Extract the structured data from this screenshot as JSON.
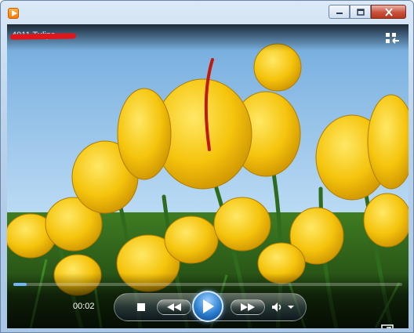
{
  "window": {
    "app_icon": "media-player-icon",
    "title_caption": "",
    "buttons": {
      "minimize": "minimize-icon",
      "maximize": "maximize-icon",
      "close": "close-icon"
    }
  },
  "media": {
    "title": "4011 Tulips",
    "switch_icon": "switch-to-library-icon"
  },
  "playback": {
    "time": "00:02",
    "progress": 0.035,
    "icons": {
      "stop": "stop-icon",
      "previous": "previous-icon",
      "play": "play-icon",
      "next": "next-icon",
      "mute": "speaker-icon",
      "volume": "chevron-down-icon",
      "fullscreen": "fullscreen-icon"
    }
  },
  "colors": {
    "accent": "#6fb6ff",
    "tulip": "#f2c20a",
    "sky": "#9dc9ee",
    "stem": "#2f6b1c"
  }
}
